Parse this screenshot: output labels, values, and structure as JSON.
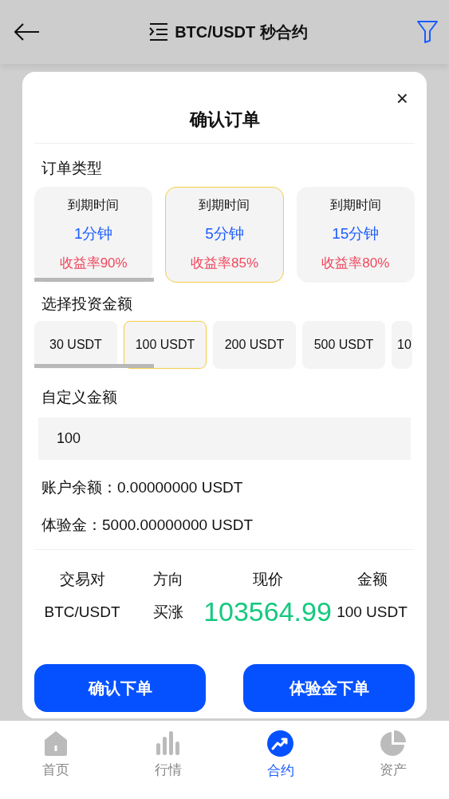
{
  "header": {
    "title": "BTC/USDT 秒合约"
  },
  "dialog": {
    "title": "确认订单",
    "close": "×",
    "order_type": {
      "label": "订单类型",
      "options": [
        {
          "caption": "到期时间",
          "duration": "1分钟",
          "rate": "收益率90%",
          "selected": false
        },
        {
          "caption": "到期时间",
          "duration": "5分钟",
          "rate": "收益率85%",
          "selected": true
        },
        {
          "caption": "到期时间",
          "duration": "15分钟",
          "rate": "收益率80%",
          "selected": false
        }
      ]
    },
    "amount": {
      "label": "选择投资金额",
      "options": [
        {
          "label": "30 USDT",
          "selected": false
        },
        {
          "label": "100 USDT",
          "selected": true
        },
        {
          "label": "200 USDT",
          "selected": false
        },
        {
          "label": "500 USDT",
          "selected": false
        },
        {
          "label": "10",
          "selected": false
        }
      ]
    },
    "custom": {
      "label": "自定义金额",
      "value": "100"
    },
    "balance": "账户余额：0.00000000 USDT",
    "trial": "体验金：5000.00000000 USDT",
    "summary": {
      "columns": [
        "交易对",
        "方向",
        "现价",
        "金额"
      ],
      "values": [
        "BTC/USDT",
        "买涨",
        "103564.99",
        "100 USDT"
      ]
    },
    "buttons": [
      "确认下单",
      "体验金下单"
    ]
  },
  "nav": [
    {
      "label": "首页",
      "kind": "home",
      "selected": false
    },
    {
      "label": "行情",
      "kind": "market",
      "selected": false
    },
    {
      "label": "合约",
      "kind": "contract",
      "selected": true
    },
    {
      "label": "资产",
      "kind": "assets",
      "selected": false
    }
  ]
}
